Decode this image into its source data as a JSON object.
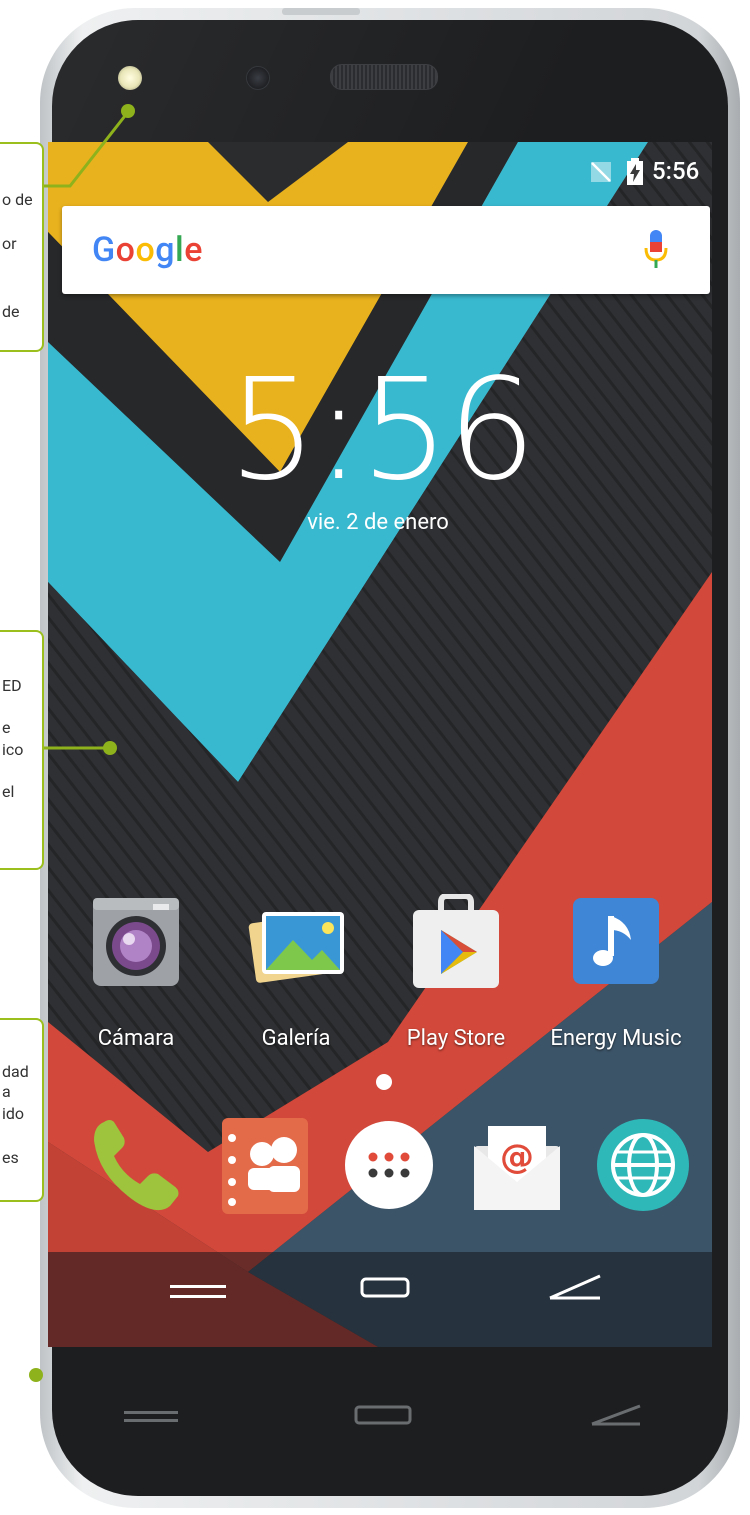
{
  "status_bar": {
    "time": "5:56",
    "icons": [
      "no-sim-icon",
      "battery-charging-icon"
    ]
  },
  "search": {
    "logo": "Google",
    "icons": [
      "mic-icon"
    ]
  },
  "lock_clock": {
    "time": "5:56",
    "date": "vie. 2 de enero"
  },
  "apps": [
    {
      "label": "Cámara",
      "icon": "camera-icon"
    },
    {
      "label": "Galería",
      "icon": "gallery-icon"
    },
    {
      "label": "Play Store",
      "icon": "play-store-icon"
    },
    {
      "label": "Energy Music",
      "icon": "music-icon"
    }
  ],
  "dock": [
    {
      "icon": "phone-icon"
    },
    {
      "icon": "contacts-icon"
    },
    {
      "icon": "app-drawer-icon"
    },
    {
      "icon": "email-icon"
    },
    {
      "icon": "browser-icon"
    }
  ],
  "nav_buttons": [
    "menu-icon",
    "home-icon",
    "back-icon"
  ],
  "callouts": [
    {
      "lines": [
        "o de",
        "or",
        "",
        "de"
      ]
    },
    {
      "lines": [
        "ED",
        "e",
        "ico",
        "el"
      ]
    },
    {
      "lines": [
        "dad",
        "a",
        "ido",
        "",
        "es"
      ]
    }
  ],
  "colors": {
    "yellow": "#e8b21e",
    "cyan": "#39b9cf",
    "red": "#d2483a",
    "navy": "#3c5468",
    "callout_green": "#9bbf1d"
  }
}
